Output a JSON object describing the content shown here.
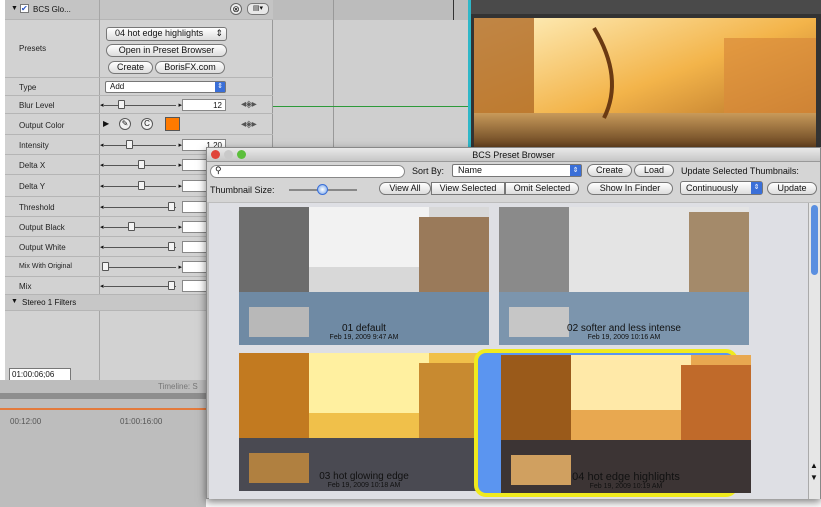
{
  "params": {
    "filter_name": "BCS Glo...",
    "presets_label": "Presets",
    "preset_value": "04 hot edge highlights",
    "open_browser": "Open in Preset Browser",
    "create": "Create",
    "borisfx": "BorisFX.com",
    "type_label": "Type",
    "type_value": "Add",
    "blur_label": "Blur Level",
    "blur_value": "12",
    "output_color_label": "Output Color",
    "output_color": "#ff7a00",
    "intensity_label": "Intensity",
    "intensity_value": "1.20",
    "deltax_label": "Delta X",
    "deltay_label": "Delta Y",
    "threshold_label": "Threshold",
    "outblack_label": "Output Black",
    "outwhite_label": "Output White",
    "mixorig_label": "Mix With Original",
    "mix_label": "Mix",
    "stereo_label": "Stereo 1 Filters",
    "timecode": "01:00:06;06",
    "timeline_label": "Timeline: S",
    "tc_a": "00:12:00",
    "tc_b": "01:00:16:00"
  },
  "browser": {
    "title": "BCS Preset Browser",
    "sort_by": "Sort By:",
    "sort_value": "Name",
    "create": "Create",
    "load": "Load",
    "update_thumbs": "Update Selected Thumbnails:",
    "thumb_size": "Thumbnail Size:",
    "view_all": "View All",
    "view_selected": "View Selected",
    "omit_selected": "Omit Selected",
    "show_finder": "Show In Finder",
    "continuously": "Continuously",
    "update": "Update",
    "items": [
      {
        "name": "01 default",
        "date": "Feb 19, 2009 9:47 AM"
      },
      {
        "name": "02 softer and less intense",
        "date": "Feb 19, 2009 10:16 AM"
      },
      {
        "name": "03 hot glowing edge",
        "date": "Feb 19, 2009 10:18 AM"
      },
      {
        "name": "04 hot edge highlights",
        "date": "Feb 19, 2009 10:19 AM"
      }
    ]
  },
  "colors": {
    "selection": "#5b95f0",
    "selection_border": "#f0ea1e",
    "accent": "#ff7a00"
  }
}
